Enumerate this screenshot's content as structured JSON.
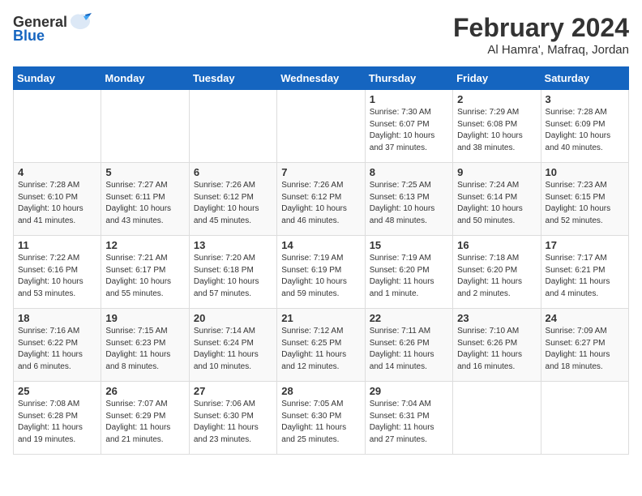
{
  "logo": {
    "general": "General",
    "blue": "Blue"
  },
  "title": "February 2024",
  "subtitle": "Al Hamra', Mafraq, Jordan",
  "days_of_week": [
    "Sunday",
    "Monday",
    "Tuesday",
    "Wednesday",
    "Thursday",
    "Friday",
    "Saturday"
  ],
  "weeks": [
    [
      {
        "day": "",
        "info": ""
      },
      {
        "day": "",
        "info": ""
      },
      {
        "day": "",
        "info": ""
      },
      {
        "day": "",
        "info": ""
      },
      {
        "day": "1",
        "info": "Sunrise: 7:30 AM\nSunset: 6:07 PM\nDaylight: 10 hours\nand 37 minutes."
      },
      {
        "day": "2",
        "info": "Sunrise: 7:29 AM\nSunset: 6:08 PM\nDaylight: 10 hours\nand 38 minutes."
      },
      {
        "day": "3",
        "info": "Sunrise: 7:28 AM\nSunset: 6:09 PM\nDaylight: 10 hours\nand 40 minutes."
      }
    ],
    [
      {
        "day": "4",
        "info": "Sunrise: 7:28 AM\nSunset: 6:10 PM\nDaylight: 10 hours\nand 41 minutes."
      },
      {
        "day": "5",
        "info": "Sunrise: 7:27 AM\nSunset: 6:11 PM\nDaylight: 10 hours\nand 43 minutes."
      },
      {
        "day": "6",
        "info": "Sunrise: 7:26 AM\nSunset: 6:12 PM\nDaylight: 10 hours\nand 45 minutes."
      },
      {
        "day": "7",
        "info": "Sunrise: 7:26 AM\nSunset: 6:12 PM\nDaylight: 10 hours\nand 46 minutes."
      },
      {
        "day": "8",
        "info": "Sunrise: 7:25 AM\nSunset: 6:13 PM\nDaylight: 10 hours\nand 48 minutes."
      },
      {
        "day": "9",
        "info": "Sunrise: 7:24 AM\nSunset: 6:14 PM\nDaylight: 10 hours\nand 50 minutes."
      },
      {
        "day": "10",
        "info": "Sunrise: 7:23 AM\nSunset: 6:15 PM\nDaylight: 10 hours\nand 52 minutes."
      }
    ],
    [
      {
        "day": "11",
        "info": "Sunrise: 7:22 AM\nSunset: 6:16 PM\nDaylight: 10 hours\nand 53 minutes."
      },
      {
        "day": "12",
        "info": "Sunrise: 7:21 AM\nSunset: 6:17 PM\nDaylight: 10 hours\nand 55 minutes."
      },
      {
        "day": "13",
        "info": "Sunrise: 7:20 AM\nSunset: 6:18 PM\nDaylight: 10 hours\nand 57 minutes."
      },
      {
        "day": "14",
        "info": "Sunrise: 7:19 AM\nSunset: 6:19 PM\nDaylight: 10 hours\nand 59 minutes."
      },
      {
        "day": "15",
        "info": "Sunrise: 7:19 AM\nSunset: 6:20 PM\nDaylight: 11 hours\nand 1 minute."
      },
      {
        "day": "16",
        "info": "Sunrise: 7:18 AM\nSunset: 6:20 PM\nDaylight: 11 hours\nand 2 minutes."
      },
      {
        "day": "17",
        "info": "Sunrise: 7:17 AM\nSunset: 6:21 PM\nDaylight: 11 hours\nand 4 minutes."
      }
    ],
    [
      {
        "day": "18",
        "info": "Sunrise: 7:16 AM\nSunset: 6:22 PM\nDaylight: 11 hours\nand 6 minutes."
      },
      {
        "day": "19",
        "info": "Sunrise: 7:15 AM\nSunset: 6:23 PM\nDaylight: 11 hours\nand 8 minutes."
      },
      {
        "day": "20",
        "info": "Sunrise: 7:14 AM\nSunset: 6:24 PM\nDaylight: 11 hours\nand 10 minutes."
      },
      {
        "day": "21",
        "info": "Sunrise: 7:12 AM\nSunset: 6:25 PM\nDaylight: 11 hours\nand 12 minutes."
      },
      {
        "day": "22",
        "info": "Sunrise: 7:11 AM\nSunset: 6:26 PM\nDaylight: 11 hours\nand 14 minutes."
      },
      {
        "day": "23",
        "info": "Sunrise: 7:10 AM\nSunset: 6:26 PM\nDaylight: 11 hours\nand 16 minutes."
      },
      {
        "day": "24",
        "info": "Sunrise: 7:09 AM\nSunset: 6:27 PM\nDaylight: 11 hours\nand 18 minutes."
      }
    ],
    [
      {
        "day": "25",
        "info": "Sunrise: 7:08 AM\nSunset: 6:28 PM\nDaylight: 11 hours\nand 19 minutes."
      },
      {
        "day": "26",
        "info": "Sunrise: 7:07 AM\nSunset: 6:29 PM\nDaylight: 11 hours\nand 21 minutes."
      },
      {
        "day": "27",
        "info": "Sunrise: 7:06 AM\nSunset: 6:30 PM\nDaylight: 11 hours\nand 23 minutes."
      },
      {
        "day": "28",
        "info": "Sunrise: 7:05 AM\nSunset: 6:30 PM\nDaylight: 11 hours\nand 25 minutes."
      },
      {
        "day": "29",
        "info": "Sunrise: 7:04 AM\nSunset: 6:31 PM\nDaylight: 11 hours\nand 27 minutes."
      },
      {
        "day": "",
        "info": ""
      },
      {
        "day": "",
        "info": ""
      }
    ]
  ]
}
